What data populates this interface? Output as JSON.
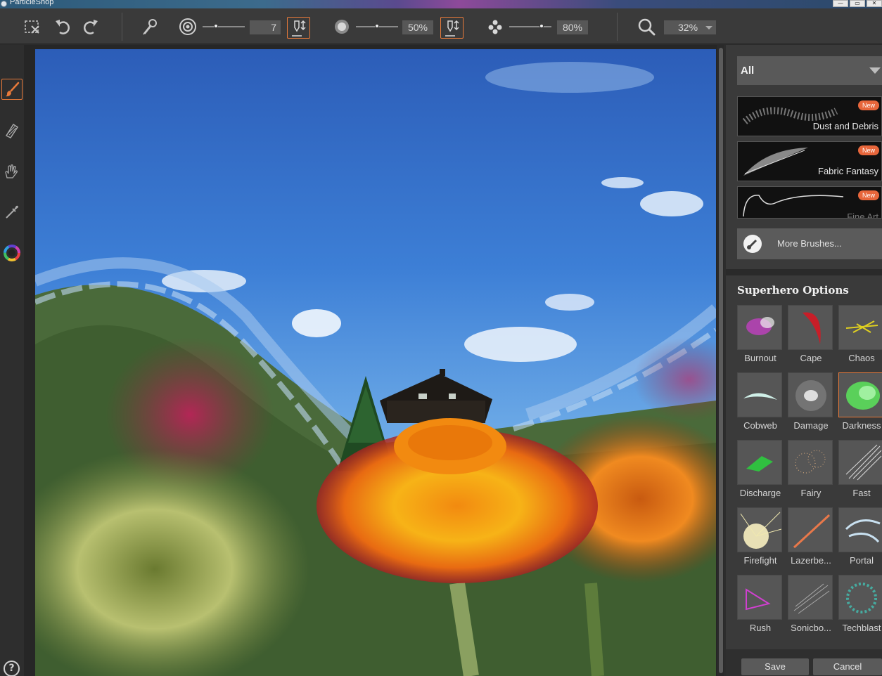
{
  "window": {
    "title": "ParticleShop",
    "controls": [
      "—",
      "▭",
      "✕"
    ]
  },
  "toolbar": {
    "brush_size": "7",
    "opacity": "50%",
    "grain": "80%",
    "zoom": "32%",
    "zoom_level": 0.32,
    "size_slider_level": 0.3,
    "opacity_slider_level": 0.5,
    "grain_slider_level": 0.8
  },
  "left_tools": [
    {
      "name": "paint-brush-tool",
      "active": true
    },
    {
      "name": "eraser-brush-tool",
      "active": false
    },
    {
      "name": "smudge-hand-tool",
      "active": false
    },
    {
      "name": "eyedropper-tool",
      "active": false
    },
    {
      "name": "color-wheel-tool",
      "active": false
    }
  ],
  "help": "?",
  "panel": {
    "category": "All",
    "packs": [
      {
        "name": "Dust and Debris",
        "badge": "New"
      },
      {
        "name": "Fabric Fantasy",
        "badge": "New"
      },
      {
        "name": "Fine Art",
        "badge": "New"
      }
    ],
    "more_brushes": "More Brushes...",
    "options_title": "Superhero Options",
    "brushes": [
      {
        "label": "Burnout",
        "selected": false
      },
      {
        "label": "Cape",
        "selected": false
      },
      {
        "label": "Chaos",
        "selected": false
      },
      {
        "label": "Cobweb",
        "selected": false
      },
      {
        "label": "Damage",
        "selected": false
      },
      {
        "label": "Darkness",
        "selected": true
      },
      {
        "label": "Discharge",
        "selected": false
      },
      {
        "label": "Fairy",
        "selected": false
      },
      {
        "label": "Fast",
        "selected": false
      },
      {
        "label": "Firefight",
        "selected": false
      },
      {
        "label": "Lazerbe...",
        "selected": false
      },
      {
        "label": "Portal",
        "selected": false
      },
      {
        "label": "Rush",
        "selected": false
      },
      {
        "label": "Sonicbo...",
        "selected": false
      },
      {
        "label": "Techblast",
        "selected": false
      }
    ],
    "save": "Save",
    "cancel": "Cancel"
  },
  "colors": {
    "accent": "#e87a3a",
    "badge": "#e7663b",
    "panel": "#3a3a3a",
    "toolbar": "#3a3a3a"
  }
}
